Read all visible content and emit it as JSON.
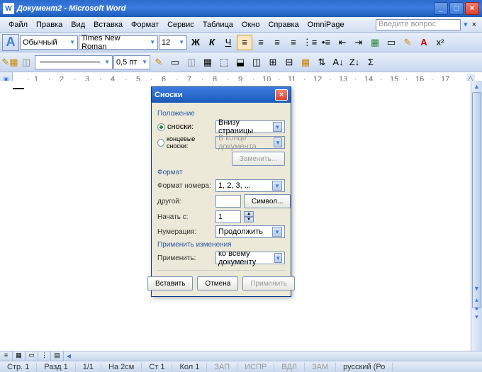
{
  "titlebar": {
    "title": "Документ2 - Microsoft Word",
    "app_icon": "W"
  },
  "menu": {
    "items": [
      "Файл",
      "Правка",
      "Вид",
      "Вставка",
      "Формат",
      "Сервис",
      "Таблица",
      "Окно",
      "Справка",
      "OmniPage"
    ],
    "ask_placeholder": "Введите вопрос"
  },
  "formatting": {
    "style": "Обычный",
    "font": "Times New Roman",
    "size": "12",
    "line_width": "0,5 пт"
  },
  "ruler_ticks": [
    "1",
    "2",
    "3",
    "4",
    "5",
    "6",
    "7",
    "8",
    "9",
    "10",
    "11",
    "12",
    "13",
    "14",
    "15",
    "16",
    "17"
  ],
  "dialog": {
    "title": "Сноски",
    "section_position": "Положение",
    "radio_footnotes": "сноски:",
    "radio_endnotes": "концевые сноски:",
    "combo_footnotes": "Внизу страницы",
    "combo_endnotes": "В конце документа",
    "btn_change": "Заменить...",
    "section_format": "Формат",
    "lbl_number_format": "Формат номера:",
    "val_number_format": "1, 2, 3, ...",
    "lbl_custom": "другой:",
    "btn_symbol": "Символ...",
    "lbl_start_at": "Начать с:",
    "val_start_at": "1",
    "lbl_numbering": "Нумерация:",
    "val_numbering": "Продолжить",
    "section_apply": "Применить изменения",
    "lbl_apply_to": "Применить:",
    "val_apply_to": "ко всему документу",
    "btn_insert": "Вставить",
    "btn_cancel": "Отмена",
    "btn_apply": "Применить"
  },
  "status": {
    "page": "Стр. 1",
    "section": "Разд 1",
    "pages": "1/1",
    "at": "На 2см",
    "line": "Ст 1",
    "col": "Кол 1",
    "rec": "ЗАП",
    "trk": "ИСПР",
    "ext": "ВДЛ",
    "ovr": "ЗАМ",
    "lang": "русский (Ро"
  }
}
